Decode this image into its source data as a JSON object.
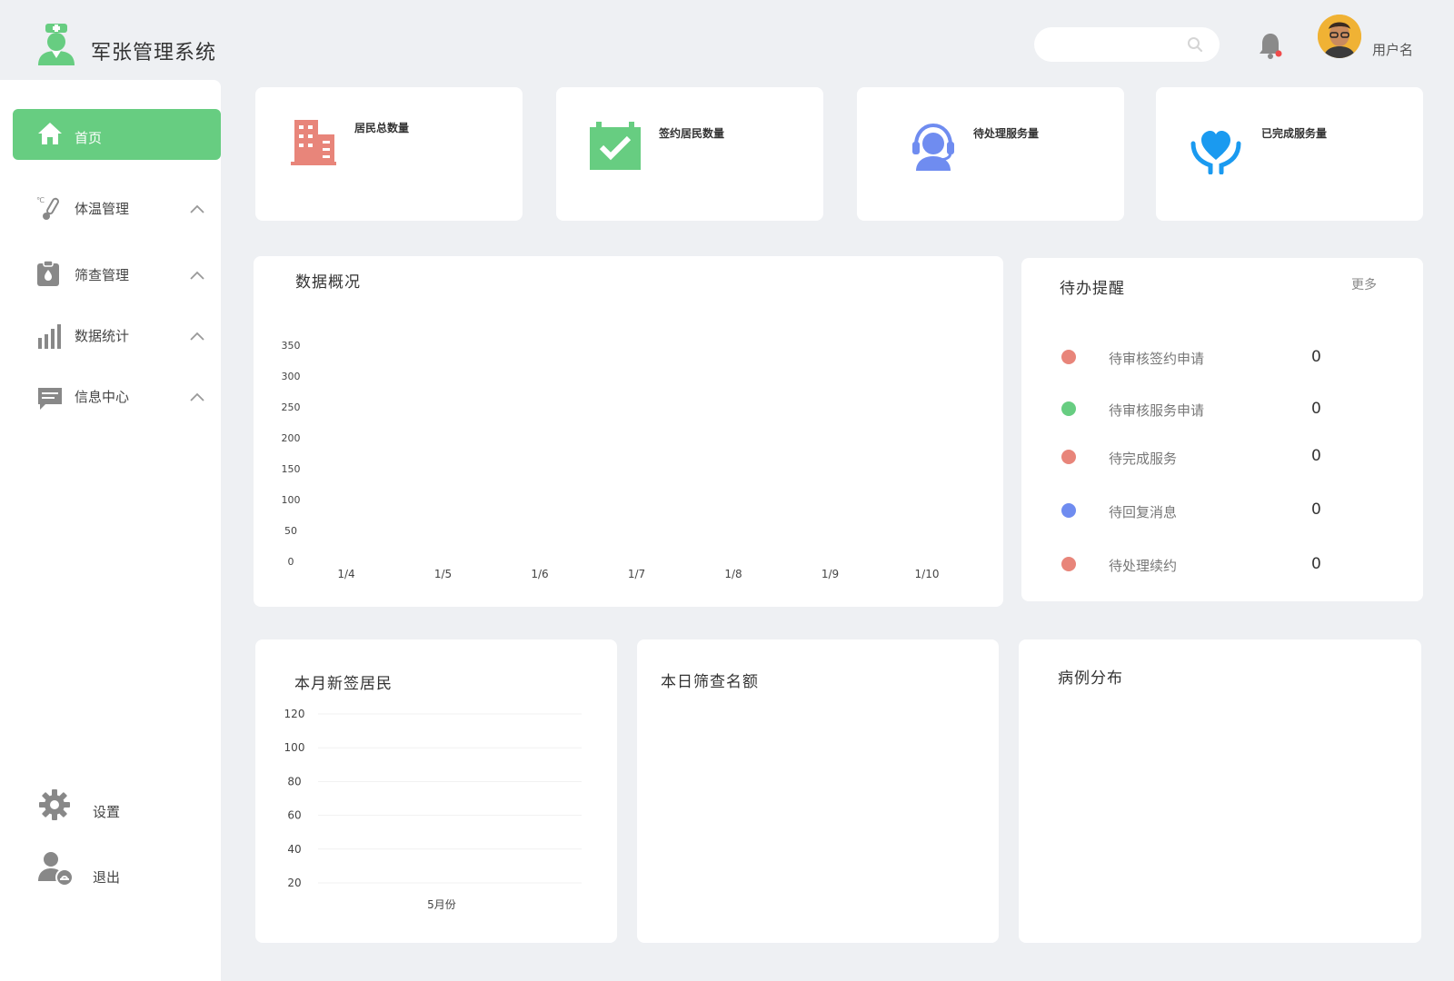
{
  "header": {
    "app_title": "军张管理系统",
    "username": "用户名"
  },
  "sidebar": {
    "home": "首页",
    "items": [
      {
        "label": "体温管理",
        "icon": "thermometer-icon"
      },
      {
        "label": "筛查管理",
        "icon": "clipboard-icon"
      },
      {
        "label": "数据统计",
        "icon": "bar-chart-icon"
      },
      {
        "label": "信息中心",
        "icon": "message-icon"
      }
    ],
    "settings": "设置",
    "logout": "退出"
  },
  "stats": [
    {
      "label": "居民总数量",
      "icon": "building-icon",
      "color": "#e8857a"
    },
    {
      "label": "签约居民数量",
      "icon": "calendar-check-icon",
      "color": "#67cd81"
    },
    {
      "label": "待处理服务量",
      "icon": "support-agent-icon",
      "color": "#6f8cf0"
    },
    {
      "label": "已完成服务量",
      "icon": "heart-hands-icon",
      "color": "#1a9af0"
    }
  ],
  "overview": {
    "title": "数据概况"
  },
  "todo": {
    "title": "待办提醒",
    "more": "更多",
    "items": [
      {
        "label": "待审核签约申请",
        "count": "0",
        "color": "#e8857a"
      },
      {
        "label": "待审核服务申请",
        "count": "0",
        "color": "#67cd81"
      },
      {
        "label": "待完成服务",
        "count": "0",
        "color": "#e8857a"
      },
      {
        "label": "待回复消息",
        "count": "0",
        "color": "#6f8cf0"
      },
      {
        "label": "待处理续约",
        "count": "0",
        "color": "#e8857a"
      }
    ]
  },
  "new_residents": {
    "title": "本月新签居民"
  },
  "screening": {
    "title": "本日筛查名额"
  },
  "cases": {
    "title": "病例分布"
  },
  "chart_data": [
    {
      "type": "line",
      "title": "数据概况",
      "x": [
        "1/4",
        "1/5",
        "1/6",
        "1/7",
        "1/8",
        "1/9",
        "1/10"
      ],
      "series": [],
      "ylim": [
        0,
        350
      ],
      "yticks": [
        "350",
        "300",
        "250",
        "200",
        "150",
        "100",
        "50",
        "0"
      ],
      "grid": false
    },
    {
      "type": "bar",
      "title": "本月新签居民",
      "categories": [
        "5月份"
      ],
      "series": [],
      "yticks": [
        "120",
        "100",
        "80",
        "60",
        "40",
        "20"
      ],
      "grid": true
    }
  ]
}
